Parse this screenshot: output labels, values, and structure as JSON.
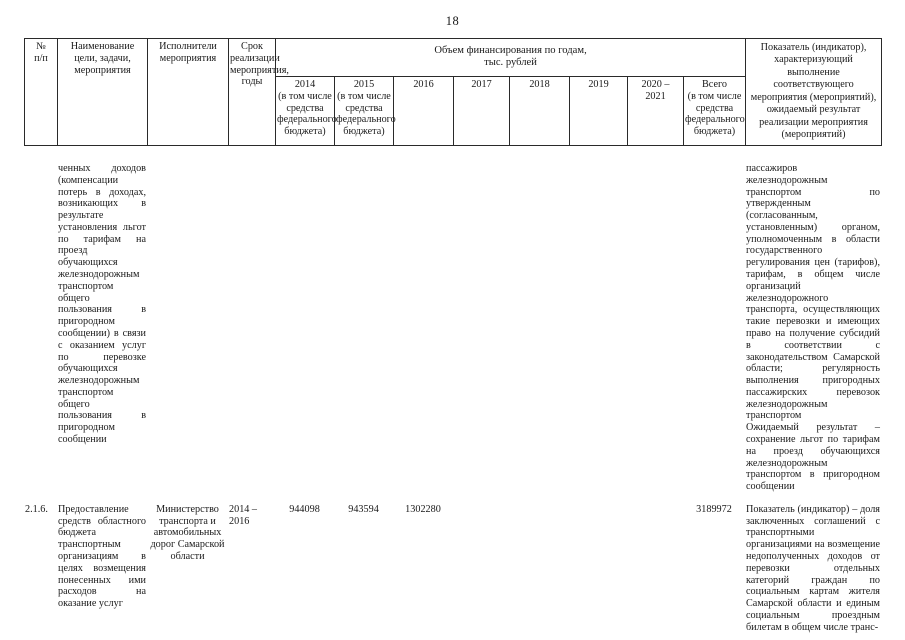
{
  "page": {
    "number": "18"
  },
  "table": {
    "header": {
      "col_np": "№\nп/п",
      "col_np_line1": "№",
      "col_np_line2": "п/п",
      "col_name": "Наименование цели, задачи, мероприятия",
      "col_executors": "Исполнители мероприятия",
      "col_term": "Срок реализации мероприятия, годы",
      "financing_title": "Объем финансирования по годам,\nтыс. рублей",
      "financing_title_line1": "Объем финансирования по годам,",
      "financing_title_line2": "тыс. рублей",
      "year_2014": "2014\n(в том числе средства федерального бюджета)",
      "year_2014_year": "2014",
      "year_2014_note": "(в том числе средства федерального бюджета)",
      "year_2015": "2015\n(в том числе средства федерального бюджета)",
      "year_2015_year": "2015",
      "year_2015_note": "(в том числе средства федерального бюджета)",
      "year_2016": "2016",
      "year_2017": "2017",
      "year_2018": "2018",
      "year_2019": "2019",
      "year_2020_2021": "2020 – 2021",
      "year_2020_2021_line1": "2020 –",
      "year_2020_2021_line2": "2021",
      "total": "Всего\n(в том числе средства федерального бюджета)",
      "total_label": "Всего",
      "total_note": "(в том числе средства федерального бюджета)",
      "indicator": "Показатель (индикатор), характеризующий выполнение соответствующего мероприятия (мероприятий), ожидаемый результат реализации мероприятия (мероприятий)"
    },
    "rows": [
      {
        "id": "continuation-row",
        "number": "",
        "name": "ченных доходов (компенсации потерь в доходах, возникающих в результате установления льгот по тарифам на проезд обучающихся железнодорожным транспортом общего пользования в пригородном сообщении) в связи с оказанием услуг по перевозке обучающихся железнодорожным транспортом общего пользования в пригородном сообщении",
        "executors": "",
        "term": "",
        "y2014": "",
        "y2015": "",
        "y2016": "",
        "y2017": "",
        "y2018": "",
        "y2019": "",
        "y2020_2021": "",
        "total": "",
        "indicator_part1": "пассажиров железнодорожным транспортом по утвержденным (согласованным, установленным) органом, уполномоченным в области государственного регулирования цен (тарифов), тарифам, в общем числе организаций железнодорожного транспорта, осуществляющих такие перевозки и имеющих право на получение субсидий в соответствии с законодательством Самарской области; регулярность выполнения пригородных пассажирских перевозок железнодорожным транспортом",
        "indicator_part2": "Ожидаемый результат – сохранение льгот по тарифам на проезд обучающихся железнодорожным транспортом в пригородном сообщении"
      },
      {
        "id": "row-2-1-6",
        "number": "2.1.6.",
        "name": "Предоставление средств областного бюджета транспортным организациям в целях возмещения понесенных ими расходов на оказание услуг",
        "executors": "Министерство транспорта и автомобильных дорог Самарской области",
        "term": "2014 – 2016",
        "term_line1": "2014 –",
        "term_line2": "2016",
        "y2014": "944098",
        "y2015": "943594",
        "y2016": "1302280",
        "y2017": "",
        "y2018": "",
        "y2019": "",
        "y2020_2021": "",
        "total": "3189972",
        "indicator_part1": "Показатель (индикатор) – доля заключенных соглашений с транспортными организациями на возмещение недополученных доходов от перевозки отдельных категорий граждан по социальным картам жителя Самарской области и единым социальным проездным билетам в общем числе транс-",
        "indicator_part2": ""
      }
    ]
  }
}
